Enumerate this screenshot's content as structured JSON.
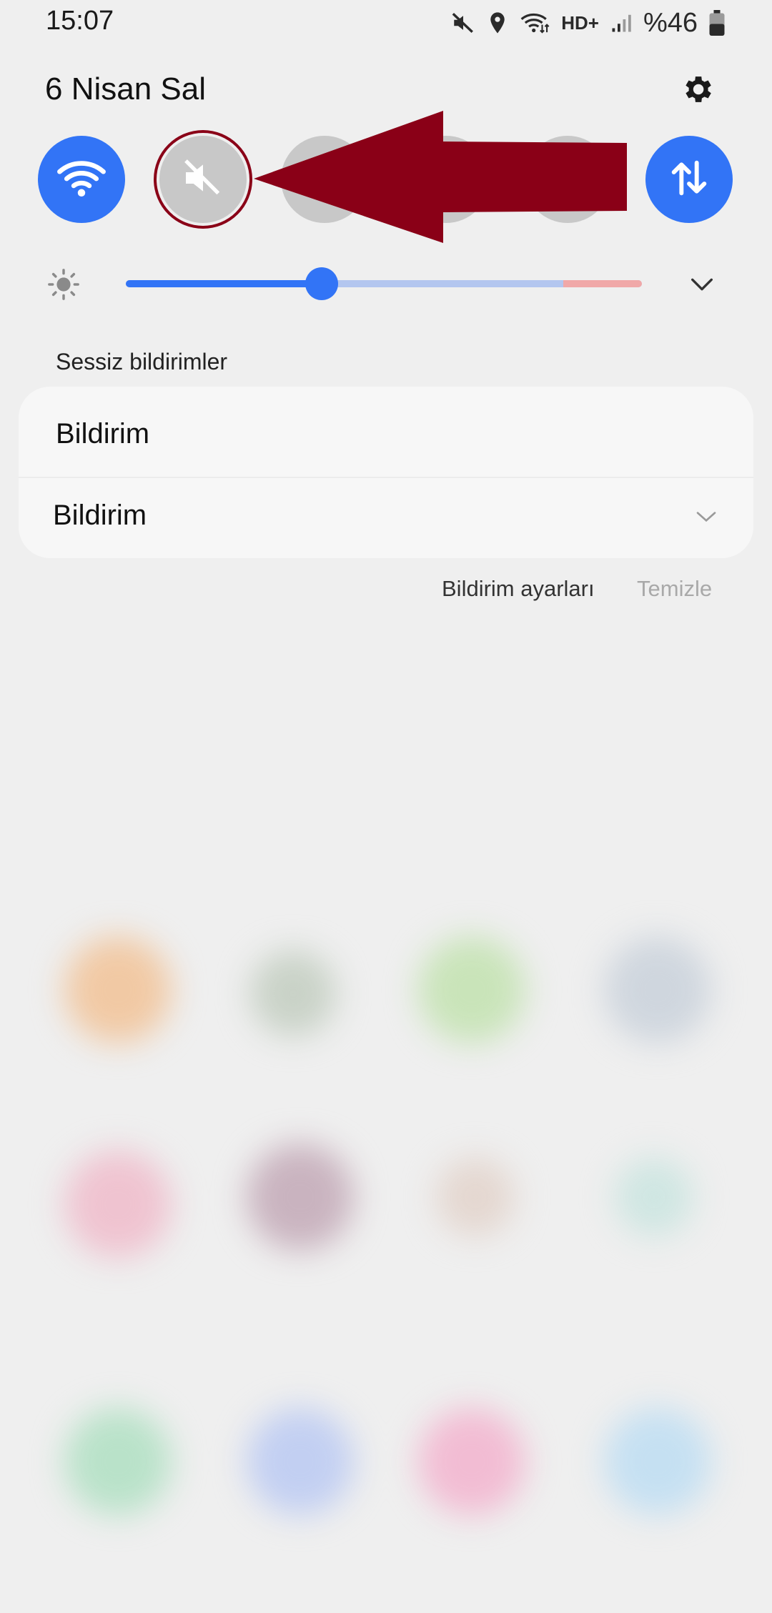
{
  "status_bar": {
    "time": "15:07",
    "network_label": "HD+",
    "battery_text": "%46",
    "icons": [
      "mute-icon",
      "location-icon",
      "wifi-data-icon",
      "signal-icon",
      "battery-icon"
    ]
  },
  "panel": {
    "date": "6 Nisan Sal",
    "settings_icon": "gear-icon"
  },
  "quick_toggles": [
    {
      "name": "wifi",
      "icon": "wifi-icon",
      "state": "on"
    },
    {
      "name": "sound",
      "icon": "mute-icon",
      "state": "off"
    },
    {
      "name": "toggle-3",
      "icon": "",
      "state": "off"
    },
    {
      "name": "toggle-4",
      "icon": "",
      "state": "off"
    },
    {
      "name": "toggle-5",
      "icon": "",
      "state": "off"
    },
    {
      "name": "mobile-data",
      "icon": "data-arrows-icon",
      "state": "on"
    }
  ],
  "brightness": {
    "level": 0.38,
    "icon": "sun-icon",
    "expand_icon": "chevron-down-icon"
  },
  "notifications": {
    "section_title": "Sessiz bildirimler",
    "items": [
      {
        "title": "Bildirim"
      },
      {
        "title": "Bildirim"
      }
    ],
    "settings_label": "Bildirim ayarları",
    "clear_label": "Temizle"
  },
  "annotation": {
    "color": "#8a0017",
    "points_to": "sound toggle"
  },
  "colors": {
    "accent": "#3274f6",
    "toggle_off": "#c8c8c8",
    "background": "#efefef"
  }
}
